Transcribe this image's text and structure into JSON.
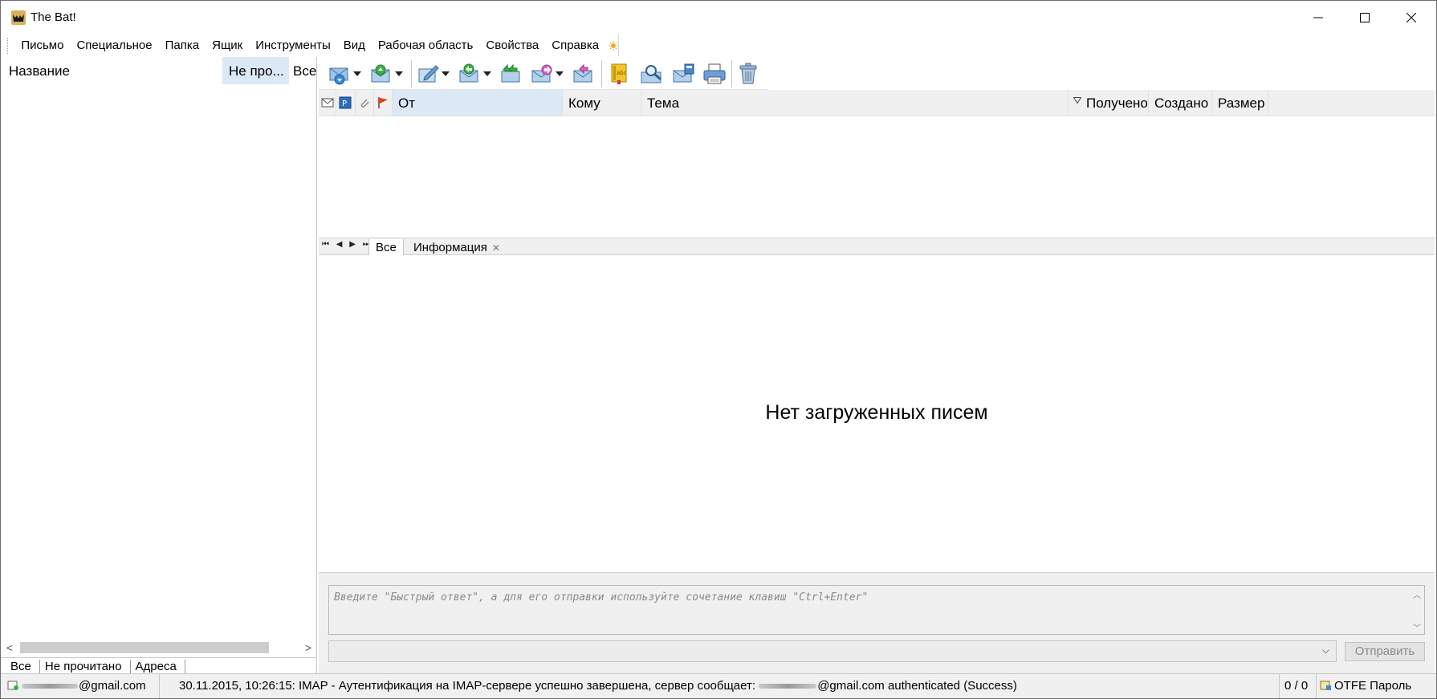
{
  "window": {
    "title": "The Bat!"
  },
  "menu": {
    "items": [
      "Письмо",
      "Специальное",
      "Папка",
      "Ящик",
      "Инструменты",
      "Вид",
      "Рабочая область",
      "Свойства",
      "Справка"
    ]
  },
  "folder_panel": {
    "col_name": "Название",
    "col_unread": "Не про...",
    "col_all": "Все",
    "tabs": [
      "Все",
      "Не прочитано",
      "Адреса"
    ]
  },
  "toolbar": {
    "icons": [
      "get-mail-icon",
      "send-mail-icon",
      "new-message-icon",
      "reply-icon",
      "reply-all-icon",
      "forward-icon",
      "redirect-icon",
      "spellcheck-icon",
      "find-icon",
      "address-book-icon",
      "print-icon",
      "delete-icon"
    ]
  },
  "message_list": {
    "columns": {
      "from": "От",
      "to": "Кому",
      "subject": "Тема",
      "received": "Получено",
      "created": "Создано",
      "size": "Размер"
    }
  },
  "preview_tabs": {
    "nav": "⏮ ◀ ▶ ⏭",
    "tab_all": "Все",
    "tab_info": "Информация",
    "close_glyph": "✕"
  },
  "preview": {
    "empty_message": "Нет загруженных писем"
  },
  "quick_reply": {
    "placeholder": "Введите \"Быстрый ответ\", а для его отправки используйте сочетание клавиш \"Ctrl+Enter\"",
    "send_label": "Отправить"
  },
  "status": {
    "account_suffix": "@gmail.com",
    "log_prefix": "30.11.2015, 10:26:15: IMAP  - Аутентификация на IMAP-сервере успешно завершена, сервер сообщает:",
    "log_suffix": "@gmail.com authenticated (Success)",
    "counter": "0 / 0",
    "otfe": "OTFE Пароль"
  },
  "colors": {
    "header_highlight": "#dbe8f6",
    "panel_bg": "#f0f0f0"
  }
}
